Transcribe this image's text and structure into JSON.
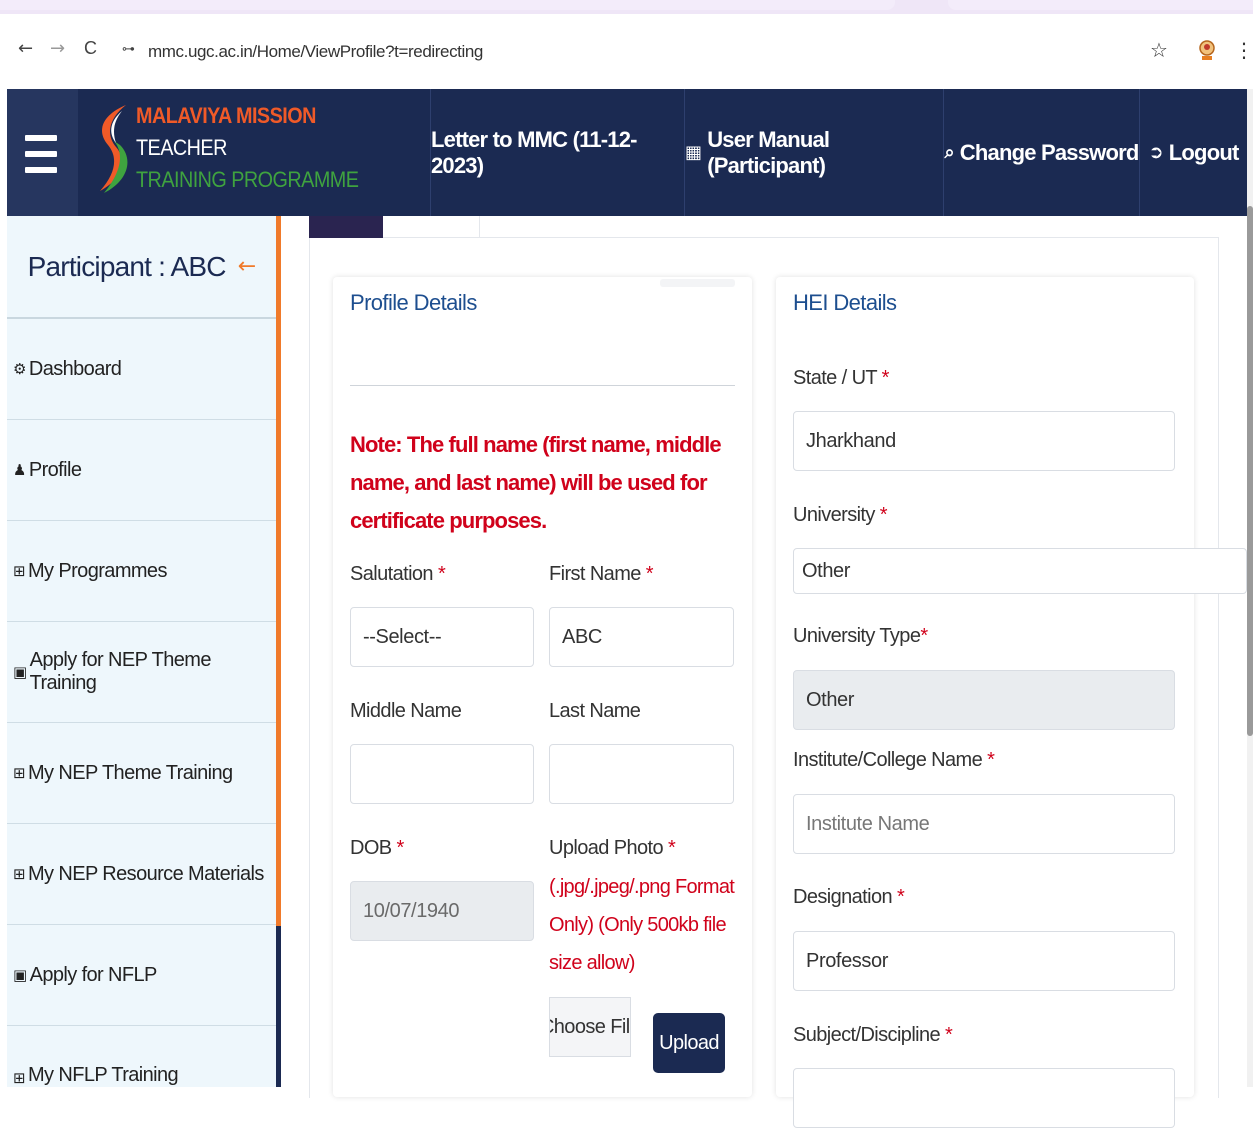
{
  "browser": {
    "back_icon": "←",
    "forward_icon": "→",
    "reload_icon": "C",
    "site_info_icon": "⊶",
    "url": "mmc.ugc.ac.in/Home/ViewProfile?t=redirecting",
    "star_icon": "☆",
    "menu_icon": "⋮"
  },
  "header": {
    "logo_line1": "MALAVIYA MISSION",
    "logo_line2": "TEACHER",
    "logo_line3": "TRAINING PROGRAMME",
    "nav": [
      {
        "icon": "",
        "label": "Letter to MMC (11-12-2023)"
      },
      {
        "icon": "📘",
        "label": "User Manual (Participant)"
      },
      {
        "icon": "🔍",
        "label": "Change Password"
      },
      {
        "icon": "⇨",
        "label": "Logout"
      }
    ],
    "colors": {
      "bg": "#1b2a52",
      "logo_orange": "#f05a28",
      "logo_green": "#3fa33f"
    }
  },
  "sidebar": {
    "title": "Participant : ABC",
    "collapse_icon": "←",
    "items": [
      {
        "icon": "⚙",
        "label": "Dashboard"
      },
      {
        "icon": "👤",
        "label": "Profile"
      },
      {
        "icon": "⊞",
        "label": "My Programmes"
      },
      {
        "icon": "▣",
        "label": "Apply for NEP Theme Training"
      },
      {
        "icon": "⊞",
        "label": "My NEP Theme Training"
      },
      {
        "icon": "⊞",
        "label": "My NEP Resource Materials"
      },
      {
        "icon": "▣",
        "label": "Apply for NFLP"
      },
      {
        "icon": "⊞",
        "label": "My NFLP Training"
      }
    ]
  },
  "profile": {
    "title": "Profile Details",
    "note": "Note: The full name (first name, middle name, and last name) will be used for certificate purposes.",
    "salutation": {
      "label": "Salutation",
      "value": "--Select--"
    },
    "first_name": {
      "label": "First Name",
      "value": "ABC"
    },
    "middle_name": {
      "label": "Middle Name",
      "value": ""
    },
    "last_name": {
      "label": "Last Name",
      "value": ""
    },
    "dob": {
      "label": "DOB",
      "value": "10/07/1940"
    },
    "upload_photo": {
      "label": "Upload Photo",
      "note": "(.jpg/.jpeg/.png Format Only) (Only 500kb file size allow)",
      "choose_label": "Choose File",
      "upload_label": "Upload"
    },
    "required_mark": "*"
  },
  "hei": {
    "title": "HEI Details",
    "state": {
      "label": "State / UT",
      "value": "Jharkhand"
    },
    "university": {
      "label": "University",
      "value": "Other"
    },
    "university_type": {
      "label": "University Type",
      "value": "Other"
    },
    "institute": {
      "label": "Institute/College Name",
      "placeholder": "Institute Name"
    },
    "designation": {
      "label": "Designation",
      "value": "Professor"
    },
    "subject": {
      "label": "Subject/Discipline"
    }
  }
}
